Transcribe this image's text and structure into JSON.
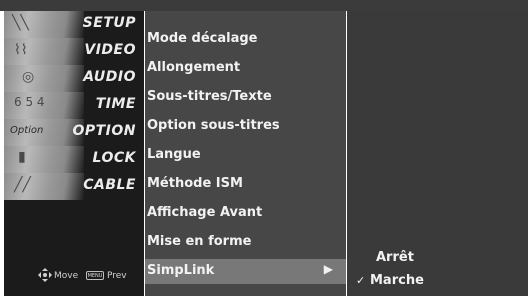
{
  "nav": {
    "items": [
      {
        "label": "SETUP"
      },
      {
        "label": "VIDEO"
      },
      {
        "label": "AUDIO"
      },
      {
        "label": "TIME"
      },
      {
        "label": "OPTION"
      },
      {
        "label": "LOCK"
      },
      {
        "label": "CABLE"
      }
    ],
    "option_thumb_text": "Option",
    "footer": {
      "move_label": "Move",
      "menu_key_label": "MENU",
      "prev_label": "Prev"
    }
  },
  "menu": {
    "items": [
      {
        "label": "Mode décalage"
      },
      {
        "label": "Allongement"
      },
      {
        "label": "Sous-titres/Texte"
      },
      {
        "label": "Option sous-titres"
      },
      {
        "label": "Langue"
      },
      {
        "label": "Méthode ISM"
      },
      {
        "label": "Affichage Avant"
      },
      {
        "label": "Mise en forme"
      },
      {
        "label": "SimpLink",
        "selected": true
      }
    ],
    "arrow_glyph": "▶"
  },
  "submenu": {
    "options": [
      {
        "label": "Arrêt",
        "checked": false
      },
      {
        "label": "Marche",
        "checked": true
      }
    ],
    "check_glyph": "✓"
  },
  "colors": {
    "topbar": "#3b3b3b",
    "nav_bg": "#1b1b1b",
    "menu_bg": "#474747",
    "menu_selected_bg": "#787878",
    "submenu_bg": "#3a3a3a",
    "text": "#f2f2f2"
  }
}
